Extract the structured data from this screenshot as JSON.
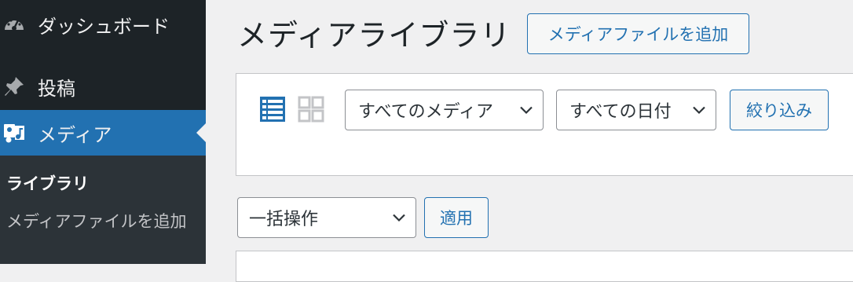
{
  "sidebar": {
    "items": [
      {
        "label": "ダッシュボード",
        "icon": "dashboard-icon"
      },
      {
        "label": "投稿",
        "icon": "pin-icon"
      },
      {
        "label": "メディア",
        "icon": "media-icon"
      }
    ],
    "submenu": {
      "library": "ライブラリ",
      "add_new": "メディアファイルを追加"
    }
  },
  "header": {
    "title": "メディアライブラリ",
    "add_new_label": "メディアファイルを追加"
  },
  "filters": {
    "media_type": "すべてのメディア",
    "date": "すべての日付",
    "filter_label": "絞り込み"
  },
  "bulk": {
    "action": "一括操作",
    "apply_label": "適用"
  },
  "colors": {
    "sidebar_bg": "#1d2327",
    "submenu_bg": "#2c3338",
    "active_bg": "#2271b1",
    "accent": "#2271b1",
    "page_bg": "#f0f0f1"
  }
}
